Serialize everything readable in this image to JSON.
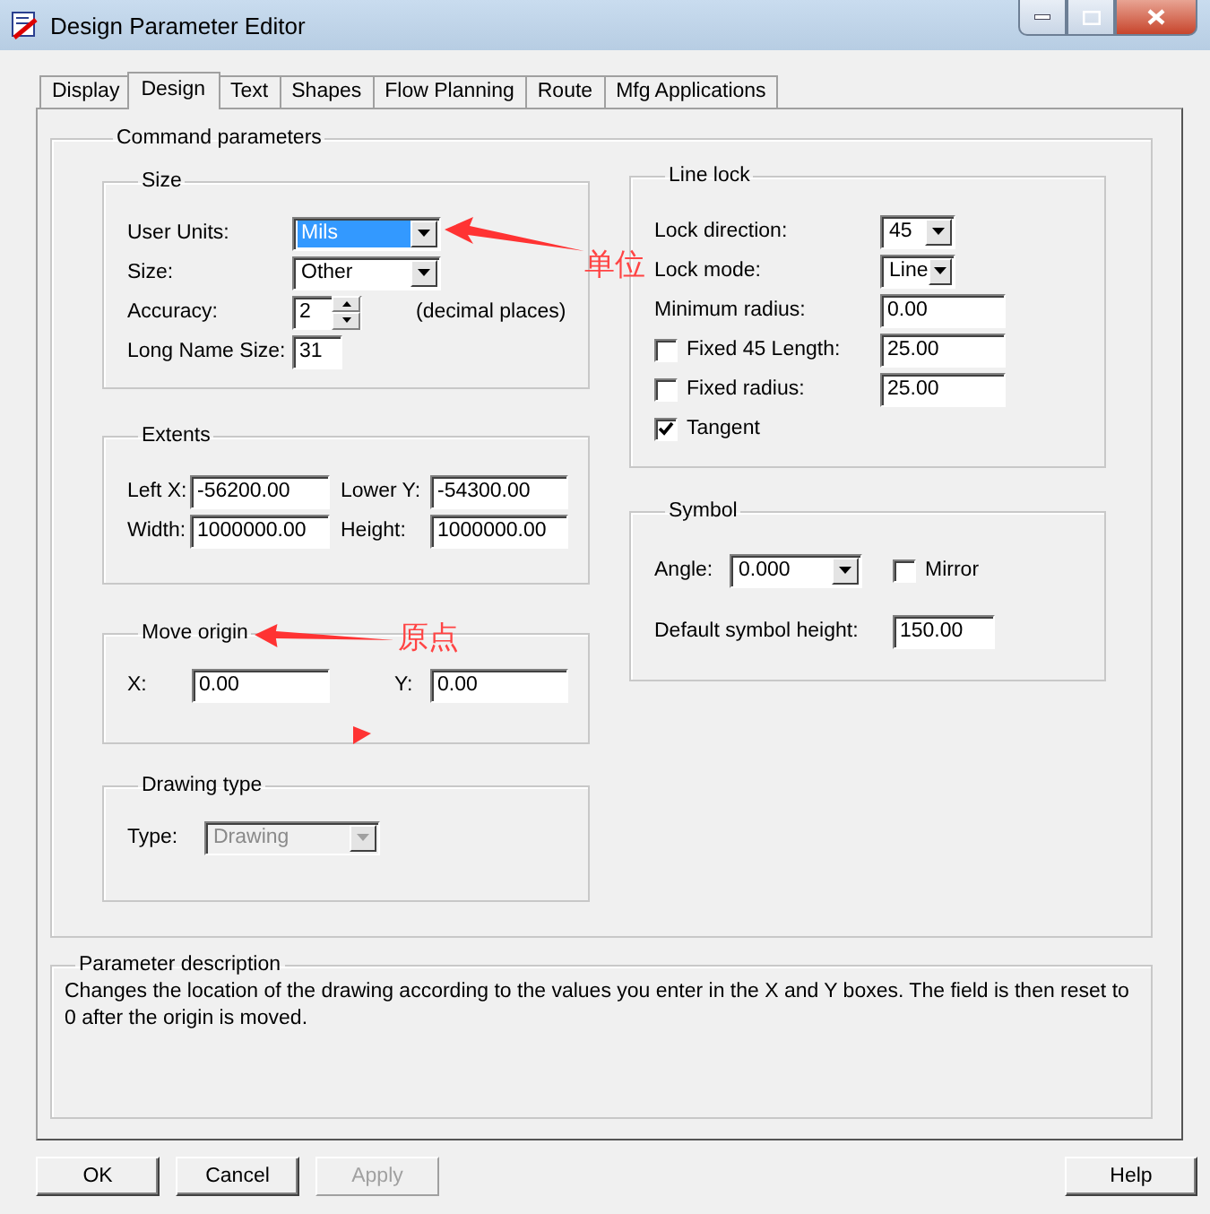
{
  "window": {
    "title": "Design Parameter Editor"
  },
  "tabs": [
    {
      "label": "Display",
      "selected": false
    },
    {
      "label": "Design",
      "selected": true
    },
    {
      "label": "Text",
      "selected": false
    },
    {
      "label": "Shapes",
      "selected": false
    },
    {
      "label": "Flow Planning",
      "selected": false
    },
    {
      "label": "Route",
      "selected": false
    },
    {
      "label": "Mfg Applications",
      "selected": false
    }
  ],
  "command_parameters": {
    "title": "Command parameters",
    "size": {
      "title": "Size",
      "user_units": {
        "label": "User Units:",
        "value": "Mils",
        "focused": true
      },
      "size": {
        "label": "Size:",
        "value": "Other",
        "focused": false
      },
      "accuracy": {
        "label": "Accuracy:",
        "value": "2",
        "note": "(decimal places)"
      },
      "long_name_size": {
        "label": "Long Name Size:",
        "value": "31"
      }
    },
    "extents": {
      "title": "Extents",
      "fields": [
        {
          "label": "Left X:",
          "value": "-56200.00"
        },
        {
          "label": "Lower Y:",
          "value": "-54300.00"
        },
        {
          "label": "Width:",
          "value": "1000000.00"
        },
        {
          "label": "Height:",
          "value": "1000000.00"
        }
      ]
    },
    "move_origin": {
      "title": "Move origin",
      "fields": [
        {
          "label": "X:",
          "value": "0.00"
        },
        {
          "label": "Y:",
          "value": "0.00"
        }
      ]
    },
    "drawing_type": {
      "title": "Drawing type",
      "type": {
        "label": "Type:",
        "value": "Drawing",
        "disabled": true
      }
    },
    "line_lock": {
      "title": "Line lock",
      "rows": [
        {
          "kind": "dropdown",
          "label": "Lock direction:",
          "value": "45"
        },
        {
          "kind": "dropdown",
          "label": "Lock mode:",
          "value": "Line"
        },
        {
          "kind": "field",
          "label": "Minimum radius:",
          "value": "0.00"
        },
        {
          "kind": "checkbox-field",
          "label": "Fixed 45 Length:",
          "checked": false,
          "value": "25.00"
        },
        {
          "kind": "checkbox-field",
          "label": "Fixed radius:",
          "checked": false,
          "value": "25.00"
        },
        {
          "kind": "checkbox",
          "label": "Tangent",
          "checked": true
        }
      ]
    },
    "symbol": {
      "title": "Symbol",
      "angle": {
        "label": "Angle:",
        "value": "0.000"
      },
      "mirror": {
        "label": "Mirror",
        "checked": false
      },
      "default_height": {
        "label": "Default symbol height:",
        "value": "150.00"
      }
    }
  },
  "parameter_description": {
    "title": "Parameter description",
    "text": "Changes the location of the drawing according to the values you enter in the X and Y boxes. The field is then reset to 0 after the origin is moved."
  },
  "buttons": [
    {
      "label": "OK",
      "disabled": false
    },
    {
      "label": "Cancel",
      "disabled": false
    },
    {
      "label": "Apply",
      "disabled": true
    },
    {
      "label": "Help",
      "disabled": false
    }
  ],
  "annotations": [
    {
      "text": "单位"
    },
    {
      "text": "原点"
    }
  ]
}
